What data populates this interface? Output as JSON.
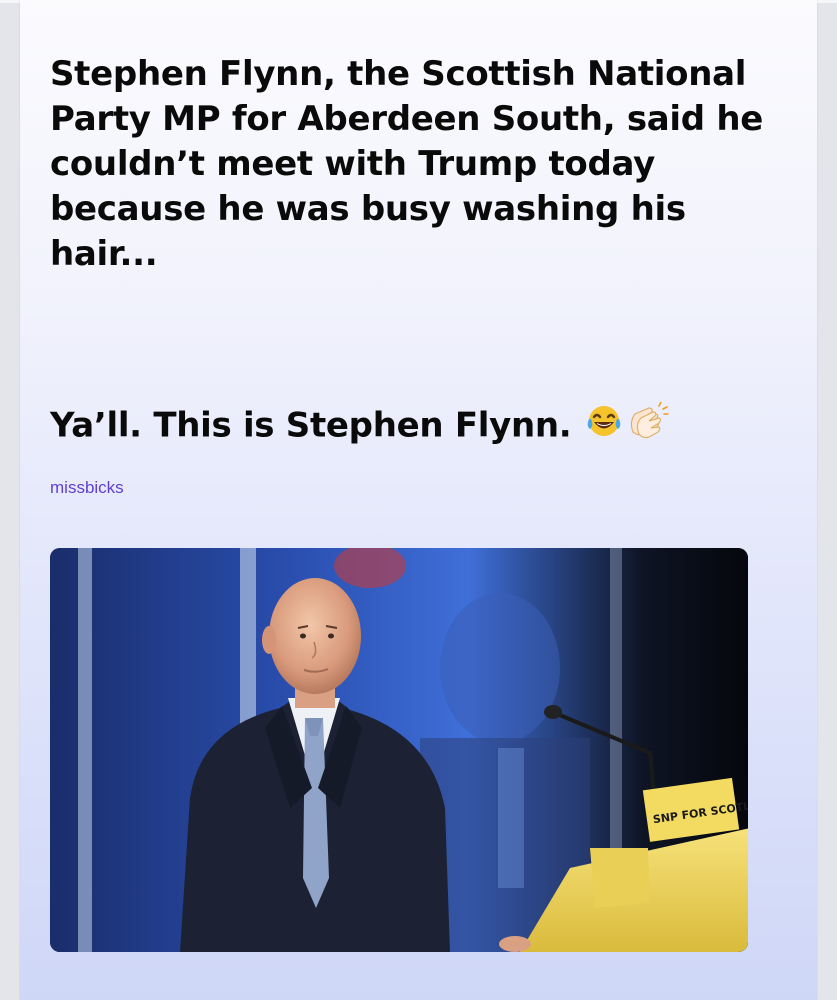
{
  "post": {
    "headline": "Stephen Flynn, the Scottish National Party MP for Aberdeen South, said he couldn’t meet with Trump today because he was busy washing his hair...",
    "punchline": "Ya’ll. This is Stephen Flynn.",
    "username": "missbicks",
    "photo": {
      "podium_sign_text": "SNP FOR SCOTLAND"
    }
  },
  "colors": {
    "username": "#5f3fcf",
    "text": "#0a0a0a",
    "podium_yellow": "#f3da61"
  },
  "icons": [
    "laughing-crying-emoji-icon",
    "clapping-hands-emoji-icon"
  ]
}
